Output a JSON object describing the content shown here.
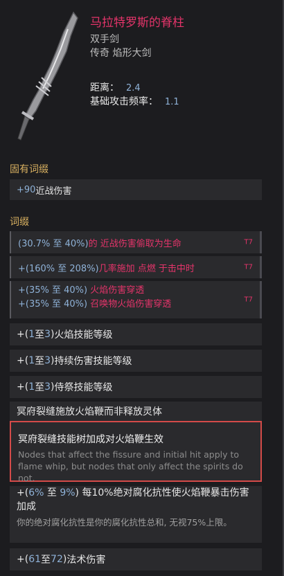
{
  "item": {
    "name": "马拉特罗斯的脊柱",
    "type": "双手剑",
    "subtype": "传奇 焰形大剑",
    "stats": [
      {
        "label": "距离：",
        "value": "2.4"
      },
      {
        "label": "基础攻击频率：",
        "value": "1.1"
      }
    ]
  },
  "implicit": {
    "title": "固有词缀",
    "rows": [
      {
        "prefix": "+90",
        "text": " 近战伤害"
      }
    ]
  },
  "affixes": {
    "title": "词缀",
    "rows": [
      {
        "range": "(30.7% 至 40%)",
        "text": " 的 近战伤害偷取为生命",
        "tier": "T7"
      },
      {
        "range": "+(160% 至 208%)",
        "text": " 几率施加 点燃 于击中时",
        "tier": "T7"
      },
      {
        "lines": [
          {
            "range": "+(35% 至 40%)",
            "text": " 火焰伤害穿透"
          },
          {
            "range": "+(35% 至 40%)",
            "text": " 召唤物火焰伤害穿透"
          }
        ],
        "tier": "T7"
      },
      {
        "plus": "+(",
        "low": "1",
        "to": " 至 ",
        "high": "3",
        "close": ") ",
        "text": "火焰技能等级"
      },
      {
        "plus": "+(",
        "low": "1",
        "to": " 至 ",
        "high": "3",
        "close": ") ",
        "text": "持续伤害技能等级"
      },
      {
        "plus": "+(",
        "low": "1",
        "to": " 至 ",
        "high": "3",
        "close": ") ",
        "text": "侍祭技能等级"
      }
    ]
  },
  "special": {
    "text": "冥府裂缝施放火焰鞭而非释放灵体"
  },
  "highlight": {
    "title": "冥府裂缝技能树加成对火焰鞭生效",
    "desc": "Nodes that affect the fissure and initial hit apply to flame whip, but nodes that only affect the spirits do not."
  },
  "resist_row": {
    "plus": "+(",
    "low": "6%",
    "to": " 至 ",
    "high": "9%",
    "close": ")",
    "main": " 每10%绝对腐化抗性使火焰鞭暴击伤害加成",
    "desc": "你的绝对腐化抗性是你的腐化抗性总和, 无视75%上限。"
  },
  "spell_row": {
    "plus": "+(",
    "low": "61",
    "to": " 至 ",
    "high": "72",
    "close": ") ",
    "text": "法术伤害"
  },
  "colors": {
    "legendary": "#e4346a",
    "affix_value": "#8fb2d8",
    "section": "#d8b060",
    "highlight_border": "#d54b49"
  },
  "icons": {
    "item_image": "flame-greatsword-icon"
  }
}
